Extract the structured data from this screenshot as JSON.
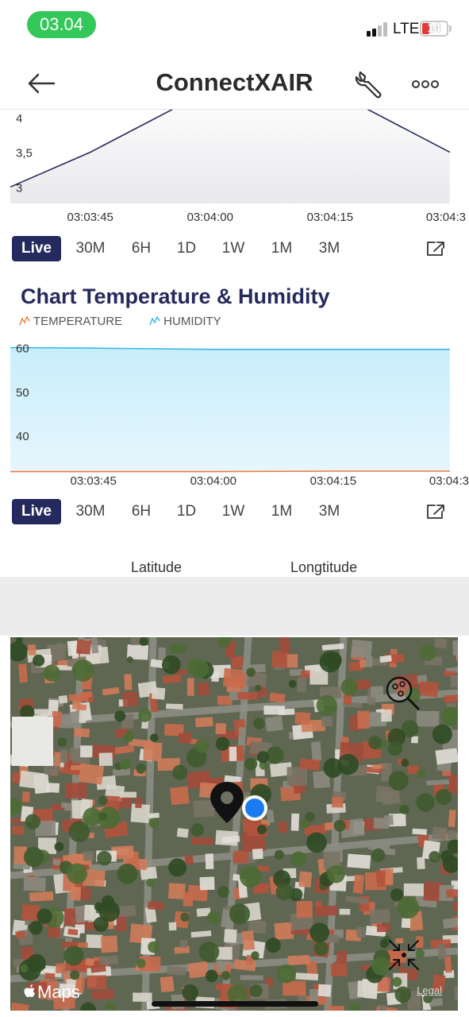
{
  "status_bar": {
    "time": "03.04",
    "network": "LTE",
    "battery": "14"
  },
  "header": {
    "title": "ConnectXAIR"
  },
  "icons": {
    "back": "arrow-left-icon",
    "settings": "wrench-icon",
    "more": "ellipsis-icon",
    "expand": "expand-icon",
    "map_search": "map-search-icon",
    "recenter": "recenter-icon",
    "pin": "location-pin-icon"
  },
  "time_ranges": [
    "Live",
    "30M",
    "6H",
    "1D",
    "1W",
    "1M",
    "3M"
  ],
  "charts": {
    "top": {
      "yticks": [
        "4",
        "3,5",
        "3"
      ],
      "xticks": [
        "03:03:45",
        "03:04:00",
        "03:04:15",
        "03:04:3"
      ]
    },
    "temp_humidity": {
      "title": "Chart Temperature & Humidity",
      "legend": [
        "TEMPERATURE",
        "HUMIDITY"
      ],
      "yticks": [
        "60",
        "50",
        "40"
      ],
      "xticks": [
        "03:03:45",
        "03:04:00",
        "03:04:15",
        "03:04:3"
      ]
    }
  },
  "chart_data": [
    {
      "type": "area",
      "x": [
        "03:03:35",
        "03:03:45",
        "03:04:00",
        "03:04:15",
        "03:04:30"
      ],
      "series": [
        {
          "values": [
            3.0,
            3.5,
            4.4,
            4.4,
            3.5
          ]
        }
      ],
      "ylim": [
        2.9,
        4.25
      ],
      "color": "#252a5e"
    },
    {
      "type": "area",
      "x": [
        "03:03:35",
        "03:03:45",
        "03:04:00",
        "03:04:15",
        "03:04:30"
      ],
      "series": [
        {
          "name": "TEMPERATURE",
          "values": [
            31.8,
            31.8,
            31.8,
            31.9,
            31.9
          ],
          "color": "#f07c3b"
        },
        {
          "name": "HUMIDITY",
          "values": [
            60.0,
            59.9,
            59.6,
            59.6,
            59.6
          ],
          "color": "#3bb6e6"
        }
      ],
      "ylim": [
        31,
        61
      ],
      "legend": "top-left"
    }
  ],
  "location": {
    "latitude_label": "Latitude",
    "longitude_label": "Longtitude"
  },
  "map": {
    "brand": "Maps",
    "legal": "Legal"
  },
  "colors": {
    "accent": "#252a5e",
    "active_range_bg": "#252a5e",
    "time_pill": "#34c759",
    "battery_low": "#e53935",
    "location_dot": "#1a7cf0"
  }
}
